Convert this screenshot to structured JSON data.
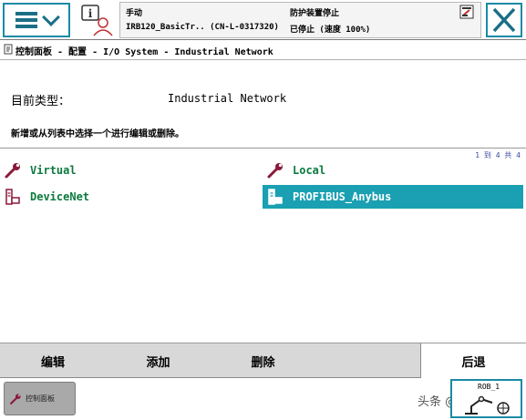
{
  "status": {
    "mode": "手动",
    "system": "IRB120_BasicTr.. (CN-L-0317320)",
    "state_line1": "防护装置停止",
    "state_line2": "已停止 (速度 100%)"
  },
  "breadcrumb": "控制面板 - 配置 - I/O System - Industrial Network",
  "current_type": {
    "label": "目前类型：",
    "value": "Industrial Network"
  },
  "instruction": "新增或从列表中选择一个进行编辑或删除。",
  "list": {
    "page_info": "1 到 4 共 4",
    "items": [
      {
        "label": "Virtual",
        "icon": "wrench-icon",
        "selected": false
      },
      {
        "label": "Local",
        "icon": "wrench-icon",
        "selected": false
      },
      {
        "label": "DeviceNet",
        "icon": "network-device-icon",
        "selected": false
      },
      {
        "label": "PROFIBUS_Anybus",
        "icon": "network-device-icon",
        "selected": true
      }
    ]
  },
  "commands": {
    "edit": "编辑",
    "add": "添加",
    "delete": "删除",
    "back": "后退"
  },
  "taskbar": {
    "control_panel": "控制面板",
    "rob_label": "ROB_1",
    "watermark": "头条 @工控小知"
  },
  "colors": {
    "accent": "#1aa0b2",
    "item_text": "#0c7a3e",
    "command_bar": "#d8d8d8"
  }
}
